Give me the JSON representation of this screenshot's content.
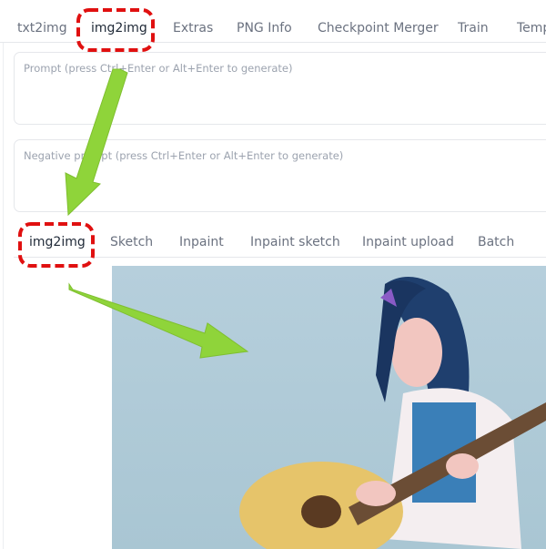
{
  "main_tabs": [
    {
      "label": "txt2img"
    },
    {
      "label": "img2img",
      "active": true
    },
    {
      "label": "Extras"
    },
    {
      "label": "PNG Info"
    },
    {
      "label": "Checkpoint Merger"
    },
    {
      "label": "Train"
    },
    {
      "label": "Temp"
    }
  ],
  "prompt": {
    "placeholder": "Prompt (press Ctrl+Enter or Alt+Enter to generate)",
    "value": ""
  },
  "negative_prompt": {
    "placeholder": "Negative prompt (press Ctrl+Enter or Alt+Enter to generate)",
    "value": ""
  },
  "sub_tabs": [
    {
      "label": "img2img",
      "active": true
    },
    {
      "label": "Sketch"
    },
    {
      "label": "Inpaint"
    },
    {
      "label": "Inpaint sketch"
    },
    {
      "label": "Inpaint upload"
    },
    {
      "label": "Batch"
    }
  ],
  "colors": {
    "highlight": "#e01010",
    "arrow": "#8fd43a",
    "image_bg": "#b0cad7"
  }
}
